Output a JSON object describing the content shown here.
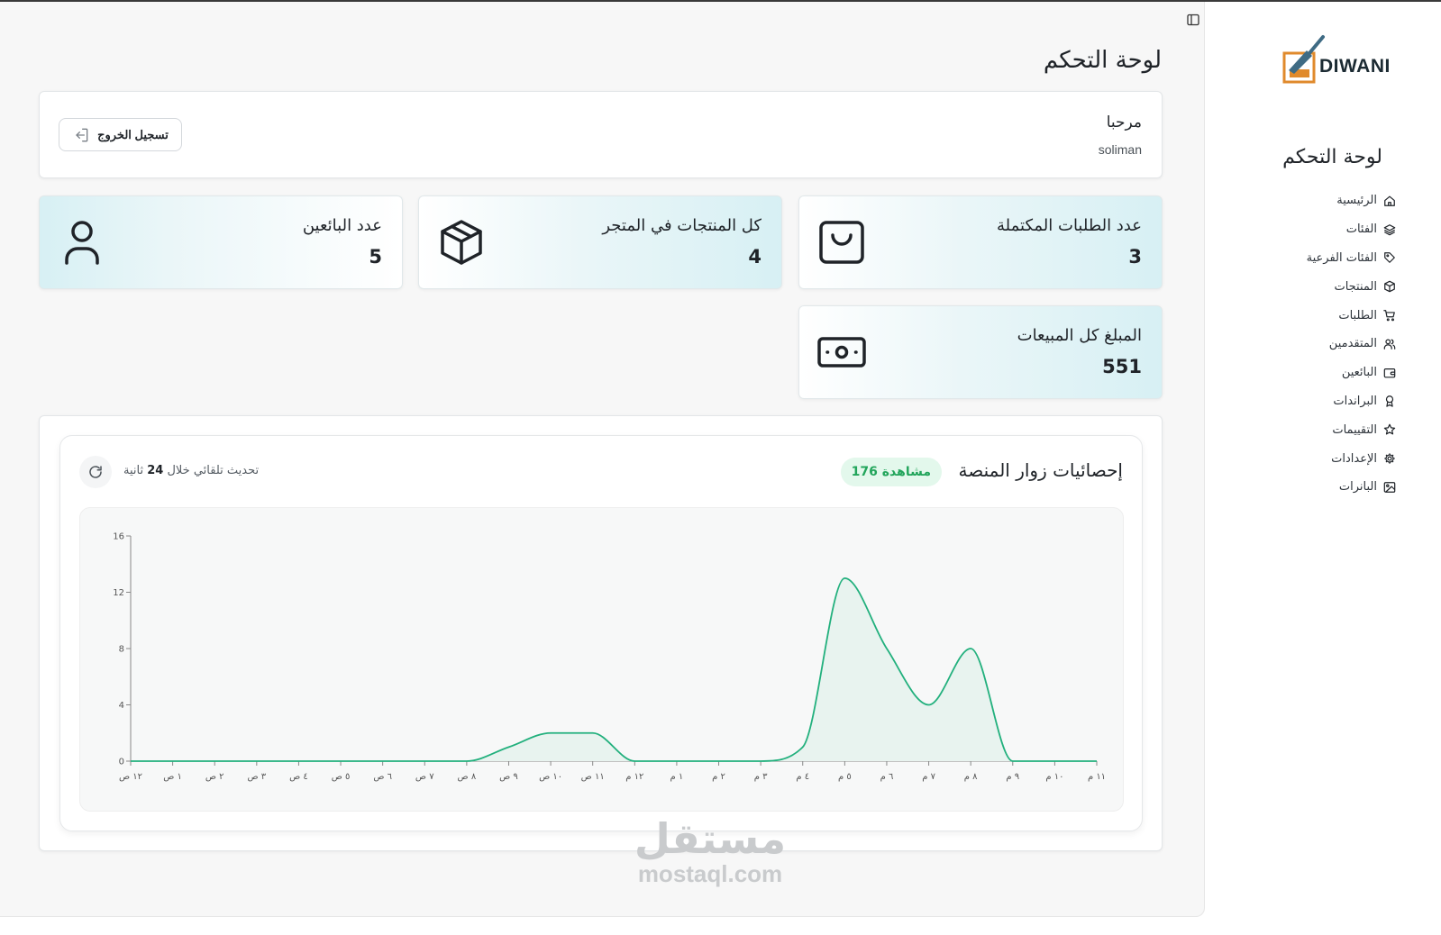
{
  "brand": {
    "name": "DIWANI"
  },
  "sidebar": {
    "title": "لوحة التحكم",
    "items": [
      {
        "label": "الرئيسية",
        "icon": "home-icon"
      },
      {
        "label": "الفئات",
        "icon": "layers-icon"
      },
      {
        "label": "الفئات الفرعية",
        "icon": "tag-icon"
      },
      {
        "label": "المنتجات",
        "icon": "box-icon"
      },
      {
        "label": "الطلبات",
        "icon": "cart-icon"
      },
      {
        "label": "المتقدمين",
        "icon": "users-icon"
      },
      {
        "label": "البائعين",
        "icon": "wallet-icon"
      },
      {
        "label": "البراندات",
        "icon": "award-icon"
      },
      {
        "label": "التقييمات",
        "icon": "star-icon"
      },
      {
        "label": "الإعدادات",
        "icon": "gear-icon"
      },
      {
        "label": "البانرات",
        "icon": "image-icon"
      }
    ]
  },
  "header": {
    "title": "لوحة التحكم"
  },
  "welcome": {
    "greeting": "مرحبا",
    "username": "soliman",
    "logout_label": "تسجيل الخروج"
  },
  "stats": {
    "completed_orders": {
      "label": "عدد الطلبات المكتملة",
      "value": "3",
      "icon": "shopping-bag-icon"
    },
    "store_products": {
      "label": "كل المنتجات في المتجر",
      "value": "4",
      "icon": "package-icon"
    },
    "sellers": {
      "label": "عدد البائعين",
      "value": "5",
      "icon": "user-icon"
    },
    "total_sales": {
      "label": "المبلغ كل المبيعات",
      "value": "551",
      "icon": "banknote-icon"
    }
  },
  "visitors": {
    "title": "إحصائيات زوار المنصة",
    "views_badge": "176 مشاهدة",
    "refresh_prefix": "تحديث تلقائي خلال",
    "refresh_seconds": "24",
    "refresh_suffix": "ثانية"
  },
  "chart_data": {
    "type": "area",
    "x": [
      "١٢ ص",
      "١ ص",
      "٢ ص",
      "٣ ص",
      "٤ ص",
      "٥ ص",
      "٦ ص",
      "٧ ص",
      "٨ ص",
      "٩ ص",
      "١٠ ص",
      "١١ ص",
      "١٢ م",
      "١ م",
      "٢ م",
      "٣ م",
      "٤ م",
      "٥ م",
      "٦ م",
      "٧ م",
      "٨ م",
      "٩ م",
      "١٠ م",
      "١١ م"
    ],
    "series": [
      {
        "values": [
          0,
          0,
          0,
          0,
          0,
          0,
          0,
          0,
          0,
          1,
          2,
          2,
          0,
          0,
          0,
          0,
          1,
          13,
          8,
          4,
          8,
          0,
          0,
          0
        ]
      }
    ],
    "ylim": [
      0,
      16
    ],
    "yticks": [
      "0",
      "4",
      "8",
      "12",
      "16"
    ],
    "color": "#22b07d",
    "fill": "#e8f3ef"
  },
  "watermark": {
    "line1": "مستقل",
    "line2": "mostaql.com"
  }
}
